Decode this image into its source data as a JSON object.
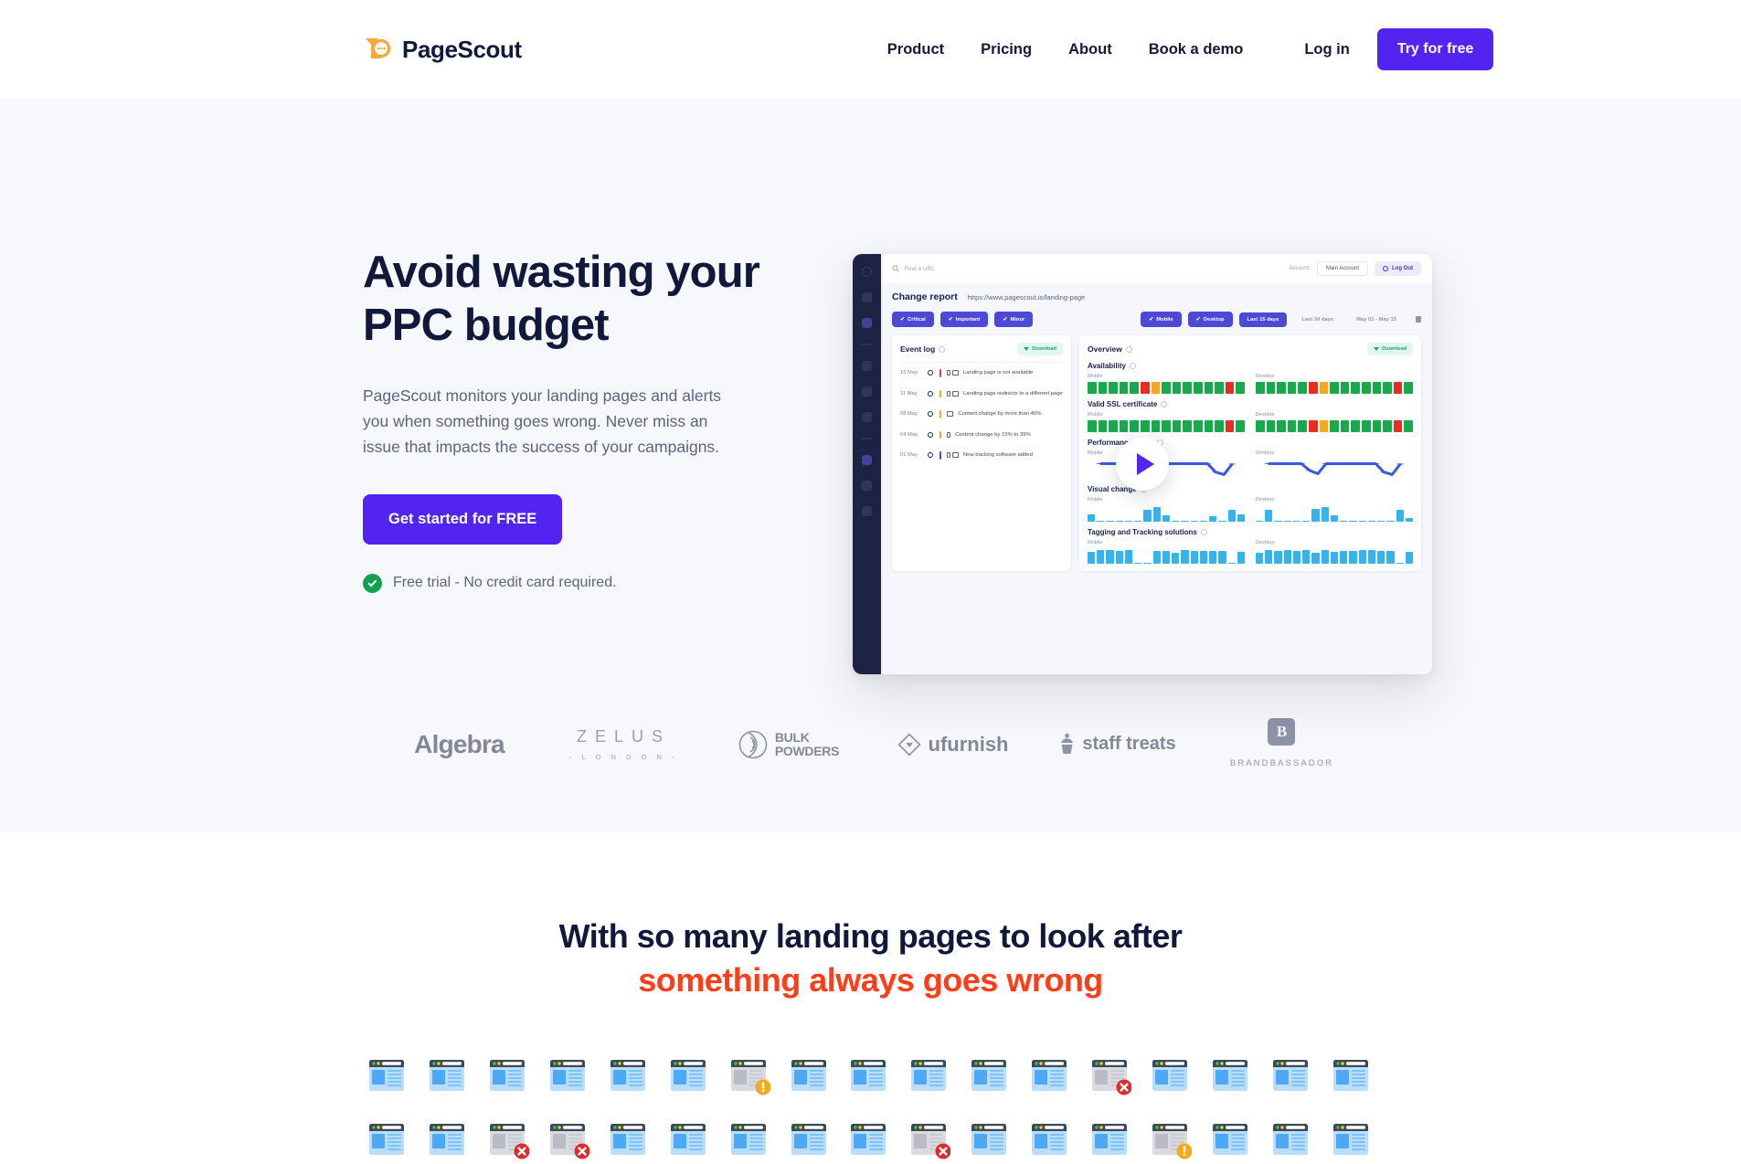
{
  "header": {
    "brand_name": "PageScout",
    "logo_icon": "megaphone-bubble-icon",
    "nav": [
      {
        "label": "Product"
      },
      {
        "label": "Pricing"
      },
      {
        "label": "About"
      },
      {
        "label": "Book a demo"
      }
    ],
    "login_label": "Log in",
    "cta_label": "Try for free",
    "cta_color": "#5323f0"
  },
  "hero": {
    "title_line1": "Avoid wasting your",
    "title_line2": "PPC budget",
    "subtitle": "PageScout monitors your landing pages and alerts you when something goes wrong. Never miss an issue that impacts the success of your campaigns.",
    "cta_label": "Get started for FREE",
    "trial_note": "Free trial - No credit card required.",
    "check_icon": "check-circle-icon",
    "play_icon": "play-icon",
    "background": "#f7f8fb"
  },
  "product_shot": {
    "search_placeholder": "Find a URL",
    "search_icon": "search-icon",
    "account_label": "Account:",
    "account_value": "Main Account",
    "logout_label": "Log Out",
    "report_title": "Change report",
    "report_url": "https://www.pagescout.io/landing-page",
    "severity_filters": [
      {
        "label": "Critical",
        "active": true
      },
      {
        "label": "Important",
        "active": true
      },
      {
        "label": "Minor",
        "active": true
      }
    ],
    "device_filters": [
      {
        "label": "Mobile",
        "active": true
      },
      {
        "label": "Desktop",
        "active": true
      }
    ],
    "range_filters": [
      {
        "label": "Last 15 days",
        "active": true
      },
      {
        "label": "Last 30 days",
        "active": false
      }
    ],
    "date_range": "May 01 - May 15",
    "event_log": {
      "title": "Event log",
      "download_label": "Download",
      "rows": [
        {
          "date": "15 May",
          "severity_color": "#ff2d6f",
          "devices": "mobile-desktop",
          "text": "Landing page is not available"
        },
        {
          "date": "11 May",
          "severity_color": "#f5a623",
          "devices": "mobile-desktop",
          "text": "Landing page redirects to a different page"
        },
        {
          "date": "08 May",
          "severity_color": "#f5a623",
          "devices": "desktop",
          "text": "Content change by more than 40%"
        },
        {
          "date": "04 May",
          "severity_color": "#f5a623",
          "devices": "mobile",
          "text": "Content change by 15% to 39%"
        },
        {
          "date": "01 May",
          "severity_color": "#4b49d6",
          "devices": "mobile-desktop",
          "text": "New tracking software added"
        }
      ]
    },
    "overview": {
      "title": "Overview",
      "download_label": "Download",
      "platform_mobile": "Mobile",
      "platform_desktop": "Desktop",
      "sections": [
        {
          "name": "Availability",
          "kind": "status"
        },
        {
          "name": "Valid SSL certificate",
          "kind": "status"
        },
        {
          "name": "Performance score",
          "kind": "line"
        },
        {
          "name": "Visual change",
          "kind": "bars"
        },
        {
          "name": "Tagging and Tracking solutions",
          "kind": "bars"
        }
      ]
    }
  },
  "chart_data": [
    {
      "type": "heatmap",
      "title": "Availability",
      "series": [
        {
          "name": "Mobile",
          "values": [
            "ok",
            "ok",
            "ok",
            "ok",
            "ok",
            "err",
            "warn",
            "ok",
            "ok",
            "ok",
            "ok",
            "ok",
            "ok",
            "err",
            "ok"
          ]
        },
        {
          "name": "Desktop",
          "values": [
            "ok",
            "ok",
            "ok",
            "ok",
            "ok",
            "err",
            "warn",
            "ok",
            "ok",
            "ok",
            "ok",
            "ok",
            "ok",
            "err",
            "ok"
          ]
        }
      ],
      "legend": {
        "ok": "#17a94c",
        "warn": "#f5a623",
        "err": "#ea2b1f"
      }
    },
    {
      "type": "heatmap",
      "title": "Valid SSL certificate",
      "series": [
        {
          "name": "Mobile",
          "values": [
            "ok",
            "ok",
            "ok",
            "ok",
            "ok",
            "ok",
            "ok",
            "ok",
            "ok",
            "ok",
            "ok",
            "ok",
            "ok",
            "err",
            "ok"
          ]
        },
        {
          "name": "Desktop",
          "values": [
            "ok",
            "ok",
            "ok",
            "ok",
            "ok",
            "err",
            "warn",
            "ok",
            "ok",
            "ok",
            "ok",
            "ok",
            "ok",
            "err",
            "ok"
          ]
        }
      ],
      "legend": {
        "ok": "#17a94c",
        "warn": "#f5a623",
        "err": "#ea2b1f"
      }
    },
    {
      "type": "line",
      "title": "Performance score",
      "series": [
        {
          "name": "Mobile",
          "values": [
            80,
            80,
            80,
            80,
            80,
            40,
            20,
            80,
            80,
            80,
            80,
            80,
            80,
            80,
            30,
            15,
            78
          ]
        },
        {
          "name": "Desktop",
          "values": [
            80,
            80,
            80,
            80,
            80,
            40,
            20,
            80,
            80,
            80,
            80,
            80,
            80,
            80,
            30,
            15,
            78
          ]
        }
      ],
      "ylim": [
        0,
        100
      ],
      "color": "#3b59e0"
    },
    {
      "type": "bar",
      "title": "Visual change",
      "series": [
        {
          "name": "Mobile",
          "values": [
            45,
            5,
            5,
            5,
            5,
            5,
            75,
            90,
            38,
            5,
            5,
            5,
            5,
            32,
            5,
            72,
            42
          ]
        },
        {
          "name": "Desktop",
          "values": [
            5,
            72,
            5,
            5,
            5,
            5,
            78,
            88,
            40,
            5,
            5,
            5,
            5,
            5,
            5,
            70,
            20
          ]
        }
      ],
      "ylim": [
        0,
        100
      ],
      "color": "#35b3ec"
    },
    {
      "type": "bar",
      "title": "Tagging and Tracking solutions",
      "series": [
        {
          "name": "Mobile",
          "values": [
            78,
            88,
            88,
            80,
            88,
            0,
            0,
            85,
            80,
            70,
            88,
            80,
            85,
            80,
            85,
            0,
            78
          ]
        },
        {
          "name": "Desktop",
          "values": [
            72,
            88,
            82,
            88,
            80,
            88,
            72,
            88,
            75,
            85,
            80,
            88,
            88,
            85,
            85,
            0,
            78
          ]
        }
      ],
      "ylim": [
        0,
        100
      ],
      "color": "#35b3ec"
    }
  ],
  "customer_logos": [
    {
      "name": "Algebra",
      "icon": "algebra-logo"
    },
    {
      "name": "ZELUS",
      "sub": "- L O N D O N -",
      "icon": "zelus-logo"
    },
    {
      "name": "BULK POWDERS",
      "icon": "bulk-powders-logo"
    },
    {
      "name": "ufurnish",
      "icon": "ufurnish-logo"
    },
    {
      "name": "staff treats",
      "icon": "staff-treats-logo"
    },
    {
      "name": "BRANDBASSADOR",
      "mark": "B",
      "icon": "brandbassador-logo"
    }
  ],
  "section2": {
    "title_line1": "With so many landing pages to look after",
    "title_line2": "something always goes wrong",
    "accent_color": "#ff3d17",
    "thumbnails": {
      "row1": [
        "ok",
        "ok",
        "ok",
        "ok",
        "ok",
        "ok",
        "warn",
        "ok",
        "ok",
        "ok",
        "ok",
        "ok",
        "err",
        "ok",
        "ok",
        "ok",
        "ok"
      ],
      "row2": [
        "ok",
        "ok",
        "err",
        "err",
        "ok",
        "ok",
        "ok",
        "ok",
        "ok",
        "err",
        "ok",
        "ok",
        "ok",
        "warn",
        "ok",
        "ok",
        "ok"
      ]
    }
  }
}
